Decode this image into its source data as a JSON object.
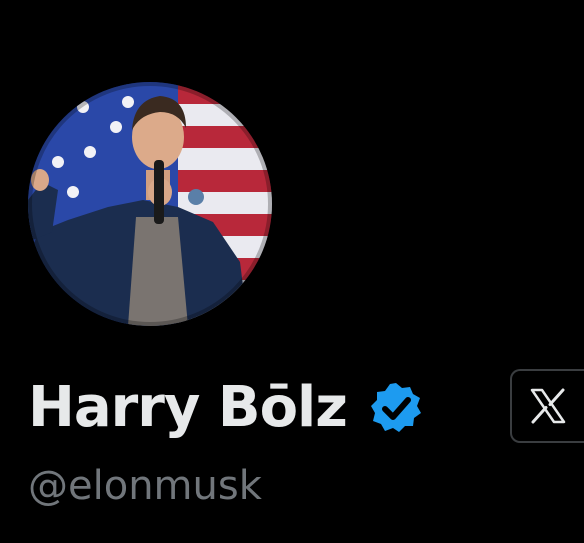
{
  "profile": {
    "display_name": "Harry Bōlz",
    "handle": "@elonmusk",
    "verified_icon": "verified-badge-icon",
    "avatar_icon": "profile-photo",
    "platform_icon": "x-logo-icon"
  },
  "colors": {
    "background": "#000000",
    "name_text": "#e7e9ea",
    "handle_text": "#71767b",
    "verified_blue": "#1d9bf0"
  }
}
